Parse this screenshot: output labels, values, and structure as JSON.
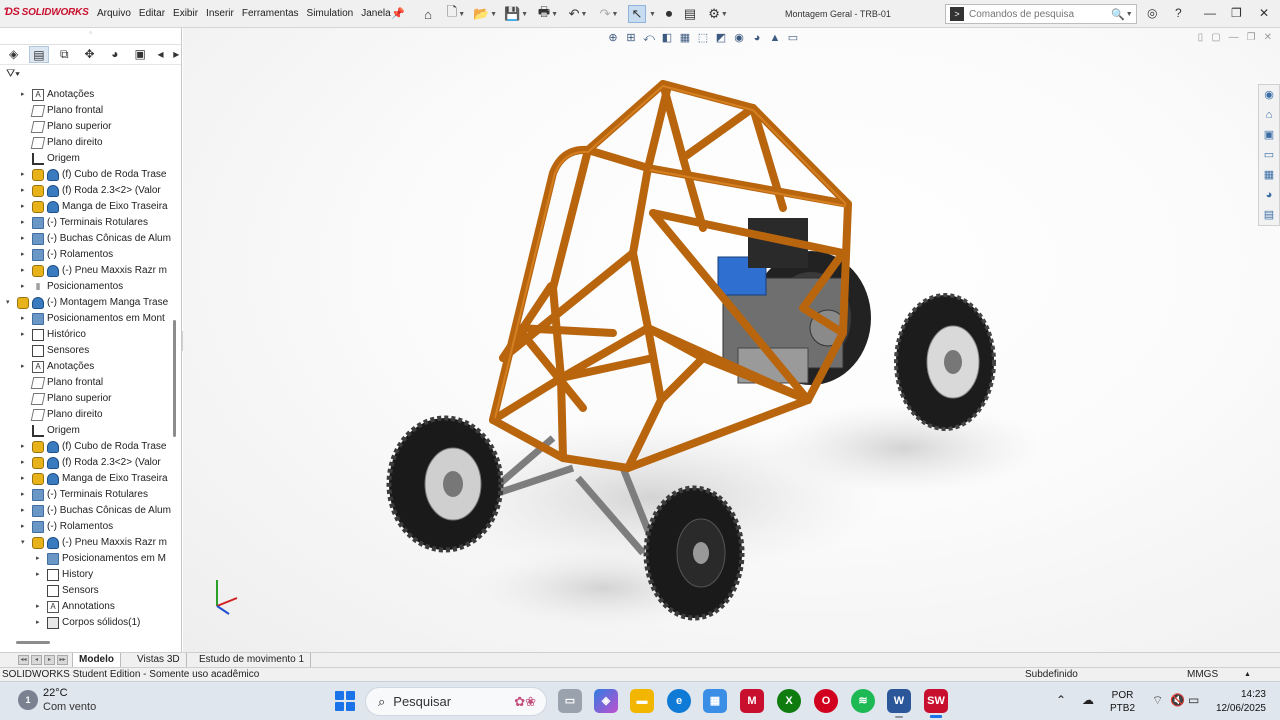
{
  "titlebar": {
    "app_name": "SOLIDWORKS",
    "menus": [
      "Arquivo",
      "Editar",
      "Exibir",
      "Inserir",
      "Ferramentas",
      "Simulation",
      "Janela"
    ],
    "document_title": "Montagem Geral - TRB-01",
    "search_placeholder": "Comandos de pesquisa"
  },
  "tree": [
    {
      "indent": 1,
      "expander": "right",
      "icon": "note",
      "label": "Anotações"
    },
    {
      "indent": 1,
      "expander": "",
      "icon": "plane",
      "label": "Plano frontal"
    },
    {
      "indent": 1,
      "expander": "",
      "icon": "plane",
      "label": "Plano superior"
    },
    {
      "indent": 1,
      "expander": "",
      "icon": "plane",
      "label": "Plano direito"
    },
    {
      "indent": 1,
      "expander": "",
      "icon": "origin",
      "label": "Origem"
    },
    {
      "indent": 1,
      "expander": "right",
      "icon": "part",
      "label": "(f) Cubo de Roda Trase"
    },
    {
      "indent": 1,
      "expander": "right",
      "icon": "part",
      "label": "(f) Roda 2.3<2> (Valor"
    },
    {
      "indent": 1,
      "expander": "right",
      "icon": "part",
      "label": "Manga de Eixo Traseira"
    },
    {
      "indent": 1,
      "expander": "right",
      "icon": "folder",
      "label": "(-) Terminais Rotulares"
    },
    {
      "indent": 1,
      "expander": "right",
      "icon": "folder",
      "label": "(-) Buchas Cônicas de Alum"
    },
    {
      "indent": 1,
      "expander": "right",
      "icon": "folder",
      "label": "(-) Rolamentos"
    },
    {
      "indent": 1,
      "expander": "right",
      "icon": "part",
      "label": "(-) Pneu Maxxis Razr m"
    },
    {
      "indent": 1,
      "expander": "right",
      "icon": "mates",
      "label": "Posicionamentos"
    },
    {
      "indent": 0,
      "expander": "down",
      "icon": "part",
      "label": "(-) Montagem Manga Trase"
    },
    {
      "indent": 1,
      "expander": "right",
      "icon": "folder",
      "label": "Posicionamentos em Mont"
    },
    {
      "indent": 1,
      "expander": "right",
      "icon": "history",
      "label": "Histórico"
    },
    {
      "indent": 1,
      "expander": "",
      "icon": "sensor",
      "label": "Sensores"
    },
    {
      "indent": 1,
      "expander": "right",
      "icon": "note",
      "label": "Anotações"
    },
    {
      "indent": 1,
      "expander": "",
      "icon": "plane",
      "label": "Plano frontal"
    },
    {
      "indent": 1,
      "expander": "",
      "icon": "plane",
      "label": "Plano superior"
    },
    {
      "indent": 1,
      "expander": "",
      "icon": "plane",
      "label": "Plano direito"
    },
    {
      "indent": 1,
      "expander": "",
      "icon": "origin",
      "label": "Origem"
    },
    {
      "indent": 1,
      "expander": "right",
      "icon": "part",
      "label": "(f) Cubo de Roda Trase"
    },
    {
      "indent": 1,
      "expander": "right",
      "icon": "part",
      "label": "(f) Roda 2.3<2> (Valor"
    },
    {
      "indent": 1,
      "expander": "right",
      "icon": "part",
      "label": "Manga de Eixo Traseira"
    },
    {
      "indent": 1,
      "expander": "right",
      "icon": "folder",
      "label": "(-) Terminais Rotulares"
    },
    {
      "indent": 1,
      "expander": "right",
      "icon": "folder",
      "label": "(-) Buchas Cônicas de Alum"
    },
    {
      "indent": 1,
      "expander": "right",
      "icon": "folder",
      "label": "(-) Rolamentos"
    },
    {
      "indent": 1,
      "expander": "down",
      "icon": "part",
      "label": "(-) Pneu Maxxis Razr m"
    },
    {
      "indent": 2,
      "expander": "right",
      "icon": "folder",
      "label": "Posicionamentos em M"
    },
    {
      "indent": 2,
      "expander": "right",
      "icon": "history",
      "label": "History"
    },
    {
      "indent": 2,
      "expander": "",
      "icon": "sensor",
      "label": "Sensors"
    },
    {
      "indent": 2,
      "expander": "right",
      "icon": "note",
      "label": "Annotations"
    },
    {
      "indent": 2,
      "expander": "right",
      "icon": "solid",
      "label": "Corpos sólidos(1)"
    }
  ],
  "bottom_tabs": [
    "Modelo",
    "Vistas 3D",
    "Estudo de movimento 1"
  ],
  "status": {
    "edition": "SOLIDWORKS Student Edition - Somente uso acadêmico",
    "state": "Subdefinido",
    "units": "MMGS"
  },
  "taskbar": {
    "weather_temp": "22°C",
    "weather_desc": "Com vento",
    "weather_badge": "1",
    "search_placeholder": "Pesquisar",
    "lang_line1": "POR",
    "lang_line2": "PTB2",
    "time": "14:23",
    "date": "12/06/2025"
  },
  "colors": {
    "frame": "#b8650e",
    "frame_dark": "#7a3f05",
    "accent_blue": "#1a73e8",
    "solidworks_red": "#c8102e"
  }
}
